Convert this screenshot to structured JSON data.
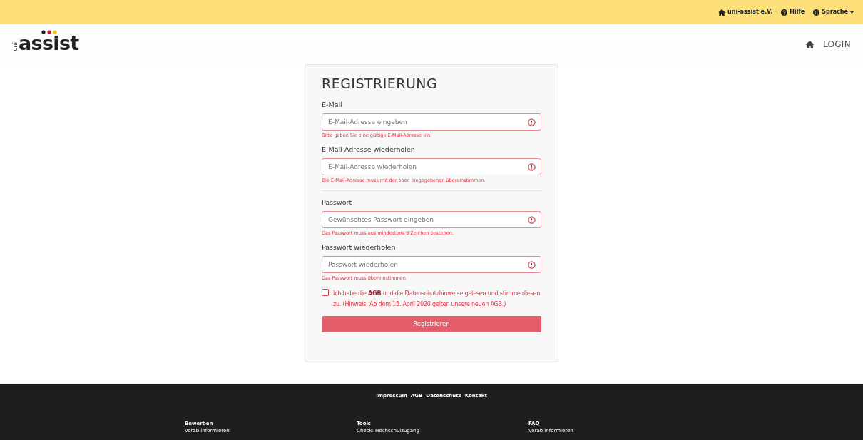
{
  "top_bar": {
    "links": [
      {
        "kind": "home",
        "label": "uni-assist e.V."
      },
      {
        "kind": "help",
        "label": "Hilfe"
      },
      {
        "kind": "language",
        "label": "Sprache"
      }
    ]
  },
  "header": {
    "logo": {
      "prefix": "uni",
      "word": "assist"
    },
    "login": "LOGIN"
  },
  "form": {
    "title": "REGISTRIERUNG",
    "fields": [
      {
        "label": "E-Mail",
        "placeholder": "E-Mail-Adresse eingeben",
        "error": "Bitte geben Sie eine gültige E-Mail-Adresse ein.",
        "invalid": true,
        "divider_after": false
      },
      {
        "label": "E-Mail-Adresse wiederholen",
        "placeholder": "E-Mail-Adresse wiederholen",
        "error": "Die E-Mail-Adresse muss mit der oben eingegebenen übereinstimmen.",
        "invalid": true,
        "divider_after": true
      },
      {
        "label": "Passwort",
        "placeholder": "Gewünschtes Passwort eingeben",
        "error": "Das Passwort muss aus mindestens 6 Zeichen bestehen.",
        "invalid": true,
        "divider_after": false
      },
      {
        "label": "Passwort wiederholen",
        "placeholder": "Passwort wiederholen",
        "error": "Das Passwort muss übereinstimmen",
        "invalid": true,
        "divider_after": false
      }
    ],
    "consent": {
      "text": "Ich habe die **AGB** und die Datenschutzhinweise gelesen und stimme diesen zu. (Hinweis: Ab dem 15. April 2020 gelten unsere neuen AGB.)",
      "checked": false,
      "invalid": true
    },
    "submit": "Registrieren"
  },
  "footer": {
    "links": [
      "Impressum",
      "AGB",
      "Datenschutz",
      "Kontakt"
    ],
    "columns": [
      {
        "heading": "Bewerben",
        "items": [
          "Vorab informieren"
        ]
      },
      {
        "heading": "Tools",
        "items": [
          "Check: Hochschulzugang"
        ]
      },
      {
        "heading": "FAQ",
        "items": [
          "Vorab informieren"
        ]
      }
    ]
  }
}
